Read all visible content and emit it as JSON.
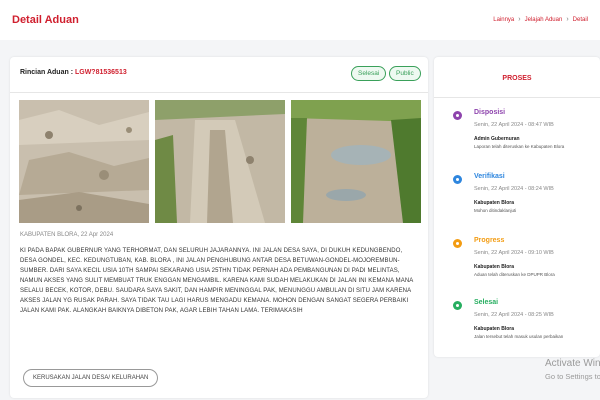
{
  "header": {
    "title": "Detail Aduan",
    "breadcrumb": [
      "Lainnya",
      "Jelajah Aduan",
      "Detail"
    ]
  },
  "detail": {
    "rincian_label": "Rincian Aduan :",
    "code": "LGW?81536513",
    "badges": [
      "Selesai",
      "Public"
    ],
    "meta": "KABUPATEN BLORA, 22 Apr 2024",
    "description": "KI PADA BAPAK GUBERNUR YANG TERHORMAT, DAN SELURUH JAJARANNYA. INI JALAN DESA SAYA, DI DUKUH KEDUNGBENDO, DESA GONDEL, KEC. KEDUNGTUBAN, KAB. BLORA , INI JALAN PENGHUBUNG ANTAR DESA BETUWAN-GONDEL-MOJOREMBUN-SUMBER. DARI SAYA KECIL USIA 10TH SAMPAI SEKARANG USIA 25THN TIDAK PERNAH ADA PEMBANGUNAN DI PADI MELINTAS, NAMUN AKSES YANG SULIT MEMBUAT TRUK ENGGAN MENGAMBIL. KARENA KAMI SUDAH MELAKUKAN DI JALAN INI KEMANA MANA SELALU BECEK, KOTOR, DEBU. SAUDARA SAYA SAKIT, DAN HAMPIR MENINGGAL PAK, MENUNGGU AMBULAN DI SITU JAM KARENA AKSES JALAN YG RUSAK PARAH. SAYA TIDAK TAU LAGI HARUS MENGADU KEMANA. MOHON DENGAN SANGAT SEGERA PERBAIKI JALAN KAMI PAK. ALANGKAH BAIKNYA DIBETON PAK, AGAR LEBIH TAHAN LAMA. TERIMAKASIH",
    "tag": "KERUSAKAN JALAN DESA/ KELURAHAN"
  },
  "progress": {
    "title": "PROSES",
    "items": [
      {
        "status": "Disposisi",
        "color": "#8e44ad",
        "time": "Senin, 22 April 2024 - 08:47 WIB",
        "actor": "Admin Gubernuran",
        "note": "Laporan telah diteruskan ke Kabupaten Blora"
      },
      {
        "status": "Verifikasi",
        "color": "#2e86de",
        "time": "Senin, 22 April 2024 - 08:24 WIB",
        "actor": "Kabupaten Blora",
        "note": "Mohon ditindaklanjuti"
      },
      {
        "status": "Progress",
        "color": "#f39c12",
        "time": "Senin, 22 April 2024 - 09:10 WIB",
        "actor": "Kabupaten Blora",
        "note": "Aduan telah diteruskan ke DPUPR Blora"
      },
      {
        "status": "Selesai",
        "color": "#27ae60",
        "time": "Senin, 22 April 2024 - 08:25 WIB",
        "actor": "Kabupaten Blora",
        "note": "Jalan tersebut telah masuk usulan perbaikan"
      }
    ]
  },
  "watermark": {
    "line1": "Activate Windows",
    "line2": "Go to Settings to activate Windows."
  }
}
